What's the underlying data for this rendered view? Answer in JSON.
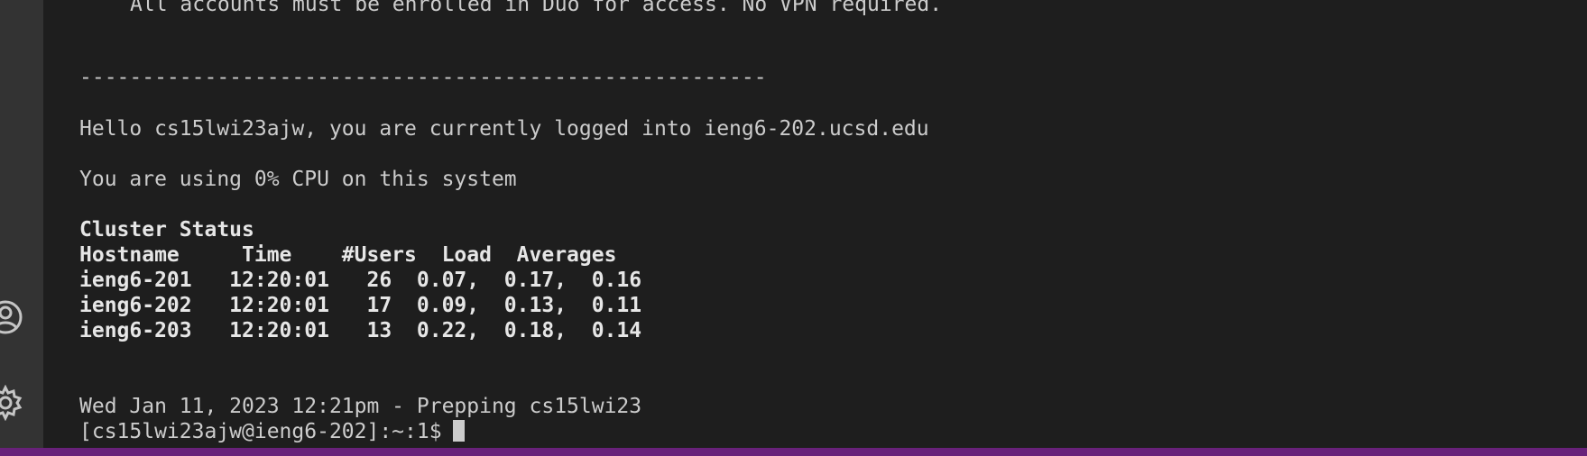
{
  "terminal": {
    "motd_line": "All accounts must be enrolled in Duo for access. No VPN required.",
    "separator": "-------------------------------------------------------",
    "greeting": "Hello cs15lwi23ajw, you are currently logged into ieng6-202.ucsd.edu",
    "cpu_line": "You are using 0% CPU on this system",
    "cluster_title": "Cluster Status",
    "cluster_header": "Hostname     Time    #Users  Load  Averages",
    "cluster_rows": [
      "ieng6-201   12:20:01   26  0.07,  0.17,  0.16",
      "ieng6-202   12:20:01   17  0.09,  0.13,  0.11",
      "ieng6-203   12:20:01   13  0.22,  0.18,  0.14"
    ],
    "date_line": "Wed Jan 11, 2023 12:21pm - Prepping cs15lwi23",
    "prompt": "[cs15lwi23ajw@ieng6-202]:~:1$"
  },
  "activity_bar": {
    "icons": [
      "account-icon",
      "gear-icon"
    ]
  },
  "colors": {
    "background": "#1e1e1e",
    "activity_bar": "#333333",
    "text": "#cccccc",
    "status_bar": "#68217a"
  }
}
